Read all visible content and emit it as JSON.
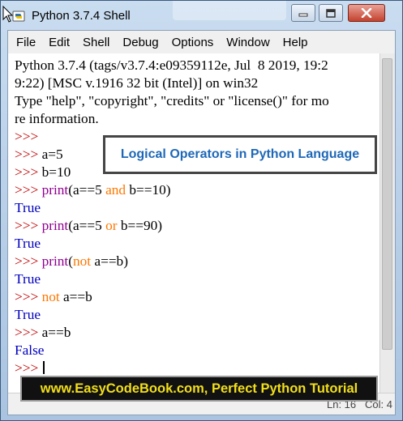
{
  "window": {
    "title": "Python 3.7.4 Shell"
  },
  "menubar": {
    "items": [
      "File",
      "Edit",
      "Shell",
      "Debug",
      "Options",
      "Window",
      "Help"
    ]
  },
  "shell": {
    "header": [
      "Python 3.7.4 (tags/v3.7.4:e09359112e, Jul  8 2019, 19:2",
      "9:22) [MSC v.1916 32 bit (Intel)] on win32",
      "Type \"help\", \"copyright\", \"credits\" or \"license()\" for mo",
      "re information."
    ],
    "prompt": ">>>",
    "lines": [
      {
        "prompt": ">>>",
        "parts": []
      },
      {
        "prompt": ">>>",
        "parts": [
          {
            "text": " a=5",
            "cls": ""
          }
        ]
      },
      {
        "prompt": ">>>",
        "parts": [
          {
            "text": " b=10",
            "cls": ""
          }
        ]
      },
      {
        "prompt": ">>>",
        "parts": [
          {
            "text": " ",
            "cls": ""
          },
          {
            "text": "print",
            "cls": "builtin"
          },
          {
            "text": "(a==5 ",
            "cls": ""
          },
          {
            "text": "and",
            "cls": "kw"
          },
          {
            "text": " b==10)",
            "cls": ""
          }
        ]
      },
      {
        "output": "True"
      },
      {
        "prompt": ">>>",
        "parts": [
          {
            "text": " ",
            "cls": ""
          },
          {
            "text": "print",
            "cls": "builtin"
          },
          {
            "text": "(a==5 ",
            "cls": ""
          },
          {
            "text": "or",
            "cls": "kw"
          },
          {
            "text": " b==90)",
            "cls": ""
          }
        ]
      },
      {
        "output": "True"
      },
      {
        "prompt": ">>>",
        "parts": [
          {
            "text": " ",
            "cls": ""
          },
          {
            "text": "print",
            "cls": "builtin"
          },
          {
            "text": "(",
            "cls": ""
          },
          {
            "text": "not",
            "cls": "kw"
          },
          {
            "text": " a==b)",
            "cls": ""
          }
        ]
      },
      {
        "output": "True"
      },
      {
        "prompt": ">>>",
        "parts": [
          {
            "text": " ",
            "cls": ""
          },
          {
            "text": "not",
            "cls": "kw"
          },
          {
            "text": " a==b",
            "cls": ""
          }
        ]
      },
      {
        "output": "True"
      },
      {
        "prompt": ">>>",
        "parts": [
          {
            "text": " a==b",
            "cls": ""
          }
        ]
      },
      {
        "output": "False"
      },
      {
        "prompt": ">>>",
        "parts": [
          {
            "text": " ",
            "cls": ""
          }
        ],
        "caret": true
      }
    ]
  },
  "status": {
    "line": "Ln: 16",
    "col": "Col: 4"
  },
  "overlays": {
    "top_banner": "Logical Operators in Python Language",
    "bottom_banner": "www.EasyCodeBook.com, Perfect Python Tutorial"
  },
  "colors": {
    "prompt": "#c00000",
    "builtin": "#900090",
    "keyword": "#ff7700",
    "output": "#0000c0",
    "banner_text": "#1e68b8",
    "bottom_banner_text": "#f2df19"
  },
  "icons": [
    "python-app-icon",
    "minimize-icon",
    "maximize-icon",
    "close-icon",
    "mouse-cursor-icon"
  ]
}
